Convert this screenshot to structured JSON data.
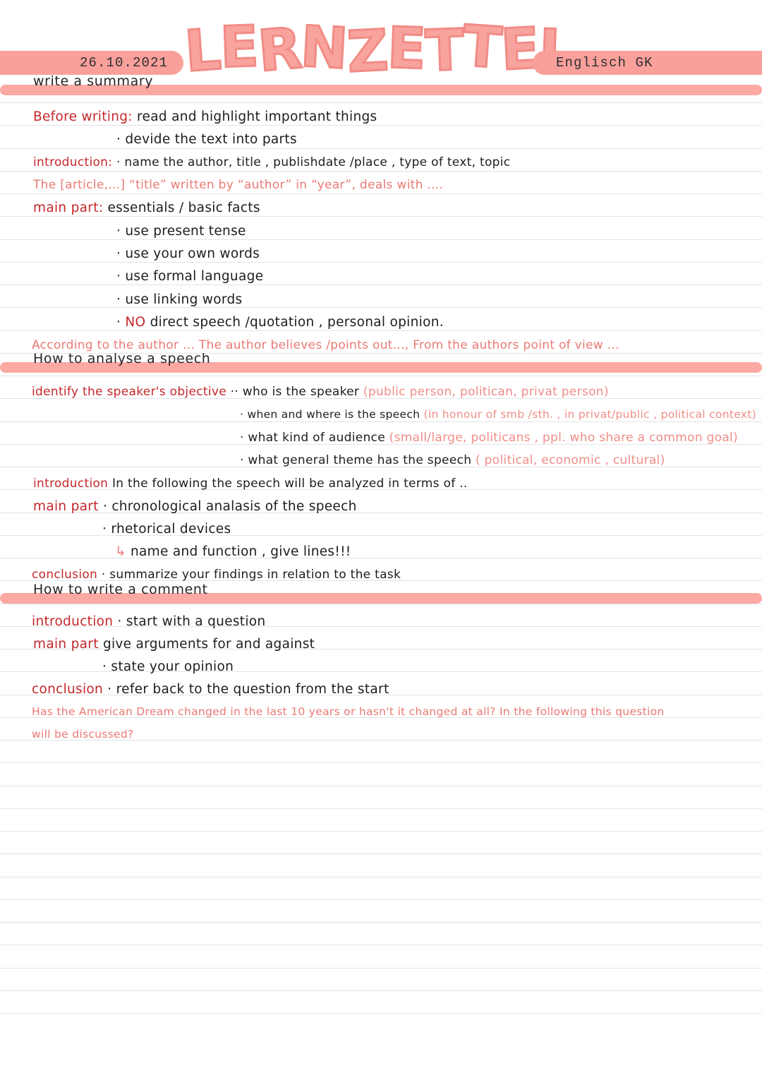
{
  "header": {
    "date": "26.10.2021",
    "title": "LERNZETTEL",
    "subject": "Englisch GK"
  },
  "colors": {
    "pink": "#f9a09a",
    "banner": "#fba9a2",
    "keyword_red": "#c4282b",
    "example_red": "#ea7a74",
    "ink": "#1d1d21",
    "rule": "#e2e3e5"
  },
  "sections": [
    {
      "banner": "write a summary",
      "lines": [
        {
          "label": "Before writing",
          "sep": ":",
          "text": "read and highlight important things"
        },
        {
          "label": "",
          "bullet": "·",
          "text": "devide the text into parts"
        },
        {
          "label": "introduction",
          "sep": ":",
          "bullet": "·",
          "text": "name the author, title , publishdate /place , type of text, topic"
        },
        {
          "example": "The [article,...] “title” written by “author” in “year”, deals with ...."
        },
        {
          "label": "main part",
          "sep": ":",
          "text": "essentials / basic facts"
        },
        {
          "bullet": "·",
          "text": "use present tense"
        },
        {
          "bullet": "·",
          "text": "use your own words"
        },
        {
          "bullet": "·",
          "text": "use  formal language"
        },
        {
          "bullet": "·",
          "text": "use  linking words"
        },
        {
          "bullet": "·",
          "no": "NO",
          "text": "direct speech /quotation , personal opinion."
        },
        {
          "example": "According to the author ... The author  believes /points out..., From the authors  point of view ..."
        }
      ]
    },
    {
      "banner": "How to analyse a speech",
      "lines": [
        {
          "label": "identify the speaker's objective",
          "bullet": "··",
          "text": "who is the speaker",
          "paren": "(public person, politican, privat person)"
        },
        {
          "bullet": "·",
          "text": "when and where is the speech",
          "paren": "(in honour of smb /sth. , in privat/public , political context)"
        },
        {
          "bullet": "·",
          "text": "what kind of audience",
          "paren": "(small/large, politicans , ppl. who  share a  common  goal)"
        },
        {
          "bullet": "·",
          "text": "what general theme has the speech",
          "paren": "( political, economic , cultural)"
        },
        {
          "label": "introduction",
          "text": "In the following the speech will be analyzed in terms of .."
        },
        {
          "label": "main part",
          "bullet": "·",
          "text": "chronological analasis of the speech"
        },
        {
          "bullet": "·",
          "text": "rhetorical devices"
        },
        {
          "arrow": "↳",
          "text": "name and  function , give lines!!!"
        },
        {
          "label": "conclusion",
          "bullet": "·",
          "text": "summarize your findings in relation to the task"
        }
      ]
    },
    {
      "banner": "How to write a comment",
      "lines": [
        {
          "label": "introduction",
          "bullet": "·",
          "text": "start with a  question"
        },
        {
          "label": "main part",
          "text": "give arguments for and against"
        },
        {
          "bullet": "·",
          "text": "state your opinion"
        },
        {
          "label": "conclusion",
          "bullet": "·",
          "text": "refer back to the question from the start"
        },
        {
          "example": "Has the  American Dream changed in the last 10 years or hasn't it changed at all? In the following this question"
        },
        {
          "example": "will be discussed?"
        }
      ]
    }
  ]
}
